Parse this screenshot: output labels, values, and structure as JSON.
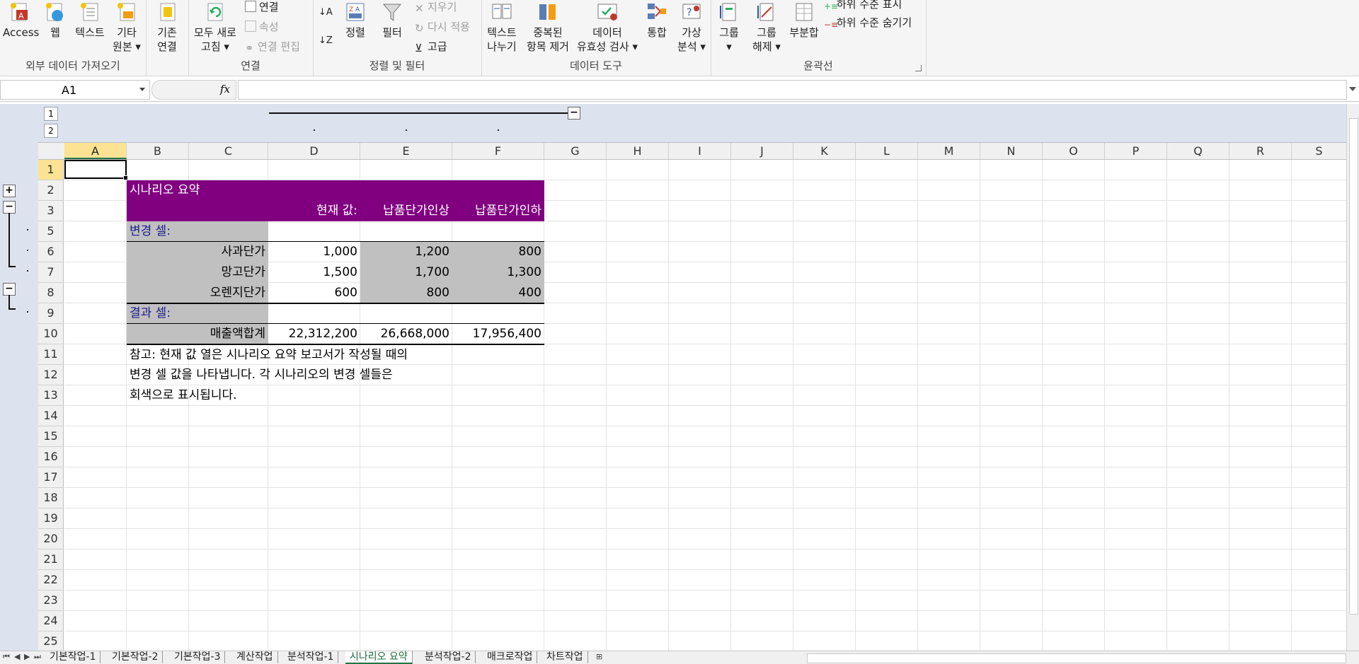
{
  "ribbon": {
    "groups": {
      "external": {
        "label": "외부 데이터 가져오기",
        "buttons": {
          "access": "Access",
          "web": "웹",
          "text": "텍스트",
          "other_l1": "기타",
          "other_l2": "원본 ▾",
          "existing_l1": "기존",
          "existing_l2": "연결"
        }
      },
      "connections": {
        "label": "연결",
        "refresh_l1": "모두 새로",
        "refresh_l2": "고침 ▾",
        "connections": "연결",
        "properties": "속성",
        "edit_links": "연결 편집"
      },
      "sort_filter": {
        "label": "정렬 및 필터",
        "sort": "정렬",
        "filter": "필터",
        "clear": "지우기",
        "reapply": "다시 적용",
        "advanced": "고급"
      },
      "data_tools": {
        "label": "데이터 도구",
        "text_to_cols_l1": "텍스트",
        "text_to_cols_l2": "나누기",
        "remove_dup_l1": "중복된",
        "remove_dup_l2": "항목 제거",
        "validation_l1": "데이터",
        "validation_l2": "유효성 검사 ▾",
        "consolidate": "통합",
        "whatif_l1": "가상",
        "whatif_l2": "분석 ▾"
      },
      "outline": {
        "label": "윤곽선",
        "group_l1": "그룹",
        "group_l2": "▾",
        "ungroup_l1": "그룹",
        "ungroup_l2": "해제 ▾",
        "subtotal": "부분합",
        "show_detail": "하위 수준 표시",
        "hide_detail": "하위 수준 숨기기"
      }
    }
  },
  "formula_bar": {
    "name_box": "A1",
    "fx": "fx",
    "formula": ""
  },
  "outline": {
    "col_levels": [
      "1",
      "2"
    ],
    "row_levels": [
      "1",
      "2"
    ],
    "plus": "+",
    "minus": "−"
  },
  "columns": [
    "A",
    "B",
    "C",
    "D",
    "E",
    "F",
    "G",
    "H",
    "I",
    "J",
    "K",
    "L",
    "M",
    "N",
    "O",
    "P",
    "Q",
    "R",
    "S"
  ],
  "rows": [
    "1",
    "2",
    "3",
    "5",
    "6",
    "7",
    "8",
    "9",
    "10",
    "11",
    "12",
    "13",
    "14",
    "15",
    "16",
    "17",
    "18",
    "19",
    "20",
    "21",
    "22",
    "23",
    "24",
    "25"
  ],
  "sheet": {
    "title": "시나리오 요약",
    "headers": {
      "current": "현재 값:",
      "up": "납품단가인상",
      "down": "납품단가인하"
    },
    "changing_label": "변경 셀:",
    "changing": [
      {
        "name": "사과단가",
        "current": "1,000",
        "up": "1,200",
        "down": "800"
      },
      {
        "name": "망고단가",
        "current": "1,500",
        "up": "1,700",
        "down": "1,300"
      },
      {
        "name": "오렌지단가",
        "current": "600",
        "up": "800",
        "down": "400"
      }
    ],
    "result_label": "결과 셀:",
    "result": {
      "name": "매출액합계",
      "current": "22,312,200",
      "up": "26,668,000",
      "down": "17,956,400"
    },
    "notes": [
      "참고: 현재 값 열은 시나리오 요약 보고서가 작성될 때의",
      "변경 셀 값을 나타냅니다. 각 시나리오의 변경 셀들은",
      "회색으로 표시됩니다."
    ]
  },
  "tabs": [
    "기본작업-1",
    "기본작업-2",
    "기본작업-3",
    "계산작업",
    "분석작업-1",
    "시나리오 요약",
    "분석작업-2",
    "매크로작업",
    "차트작업"
  ],
  "active_tab": "시나리오 요약",
  "colors": {
    "header_purple": "#800080",
    "changing_gray": "#c0c0c0",
    "label_navy": "#1a1a8c",
    "selection": "#fce393"
  }
}
